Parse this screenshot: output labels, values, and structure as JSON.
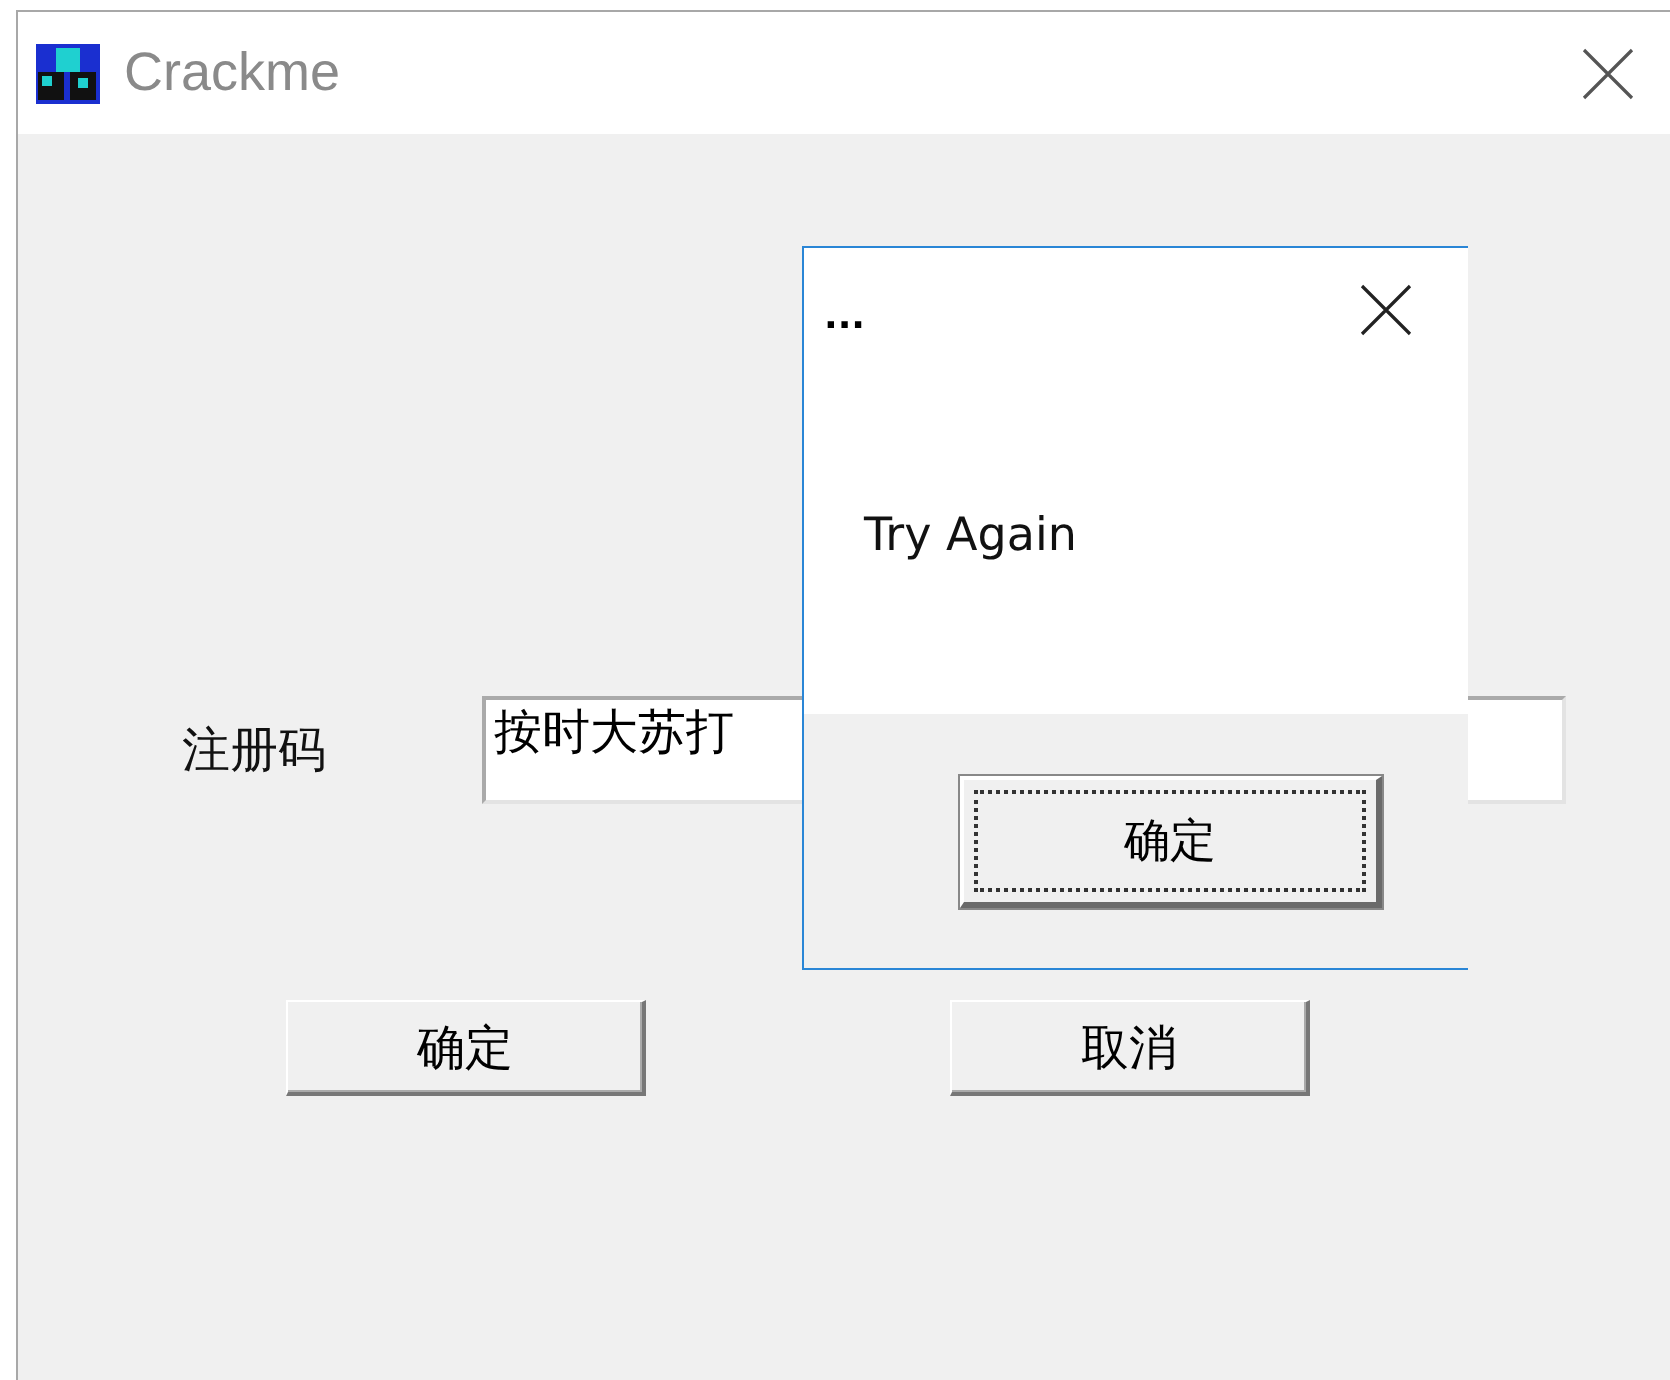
{
  "window": {
    "title": "Crackme"
  },
  "form": {
    "label": "注册码",
    "field": {
      "value": "按时大苏打"
    },
    "buttons": [
      "确定",
      "取消"
    ]
  },
  "dialog": {
    "title": "...",
    "message": "Try Again",
    "buttons": [
      {
        "label": "确定",
        "focused": true
      }
    ]
  }
}
